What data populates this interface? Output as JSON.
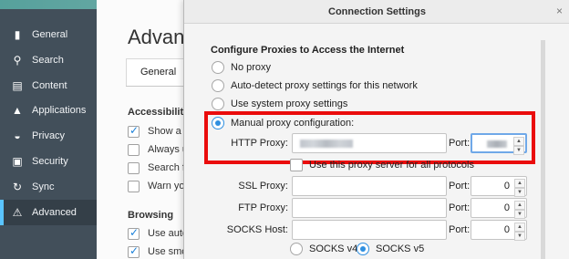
{
  "sidebar": {
    "items": [
      {
        "label": "General",
        "icon": "switch-icon",
        "glyph": "▮"
      },
      {
        "label": "Search",
        "icon": "search-icon",
        "glyph": "⚲"
      },
      {
        "label": "Content",
        "icon": "content-icon",
        "glyph": "▤"
      },
      {
        "label": "Applications",
        "icon": "rocket-icon",
        "glyph": "▲"
      },
      {
        "label": "Privacy",
        "icon": "mask-icon",
        "glyph": "◒"
      },
      {
        "label": "Security",
        "icon": "lock-icon",
        "glyph": "▣"
      },
      {
        "label": "Sync",
        "icon": "sync-icon",
        "glyph": "↻"
      },
      {
        "label": "Advanced",
        "icon": "wizard-hat-icon",
        "glyph": "⚠"
      }
    ],
    "active": "Advanced"
  },
  "prefs": {
    "title": "Advanc",
    "tab": "General",
    "sections": {
      "accessibility": "Accessibility",
      "browsing": "Browsing"
    },
    "accessibility_items": [
      "Show a t",
      "Always u",
      "Search fo",
      "Warn yo"
    ],
    "browsing_items": [
      "Use auto",
      "Use smo"
    ]
  },
  "dialog": {
    "title": "Connection Settings",
    "close_glyph": "×",
    "heading": "Configure Proxies to Access the Internet",
    "options": {
      "no_proxy": "No proxy",
      "auto_detect": "Auto-detect proxy settings for this network",
      "system": "Use system proxy settings",
      "manual": "Manual proxy configuration:"
    },
    "selected_option": "manual",
    "http_label": "HTTP Proxy:",
    "port_label": "Port:",
    "use_for_all": "Use this proxy server for all protocols",
    "ssl_label": "SSL Proxy:",
    "ftp_label": "FTP Proxy:",
    "socks_label": "SOCKS Host:",
    "ssl_port": "0",
    "ftp_port": "0",
    "socks_port": "0",
    "socks_v4": "SOCKS v4",
    "socks_v5": "SOCKS v5",
    "socks_version": "v5",
    "highlight_color": "#ea0c0c",
    "accent_color": "#2f8fe0"
  }
}
